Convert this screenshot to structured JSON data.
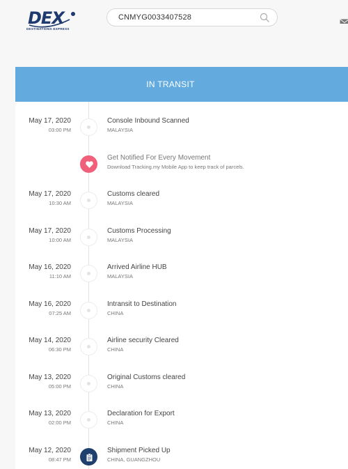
{
  "header": {
    "logo": {
      "brand": "DEX",
      "tagline": "DESTINATIONS EXPRESS"
    },
    "search": {
      "value": "CNMYG0033407528"
    }
  },
  "status": {
    "label": "IN TRANSIT"
  },
  "promo": {
    "title": "Get Notified For Every Movement",
    "description": "Download Tracking.my Mobile App to keep track of parcels."
  },
  "events": [
    {
      "date": "May 17, 2020",
      "time": "03:00 PM",
      "title": "Console Inbound Scanned",
      "location": "MALAYSIA"
    },
    {
      "date": "May 17, 2020",
      "time": "10:30 AM",
      "title": "Customs cleared",
      "location": "MALAYSIA"
    },
    {
      "date": "May 17, 2020",
      "time": "10:00 AM",
      "title": "Customs Processing",
      "location": "MALAYSIA"
    },
    {
      "date": "May 16, 2020",
      "time": "11:10 AM",
      "title": "Arrived Airline HUB",
      "location": "MALAYSIA"
    },
    {
      "date": "May 16, 2020",
      "time": "07:25 AM",
      "title": "Intransit to Destination",
      "location": "CHINA"
    },
    {
      "date": "May 14, 2020",
      "time": "06:30 PM",
      "title": "Airline security Cleared",
      "location": "CHINA"
    },
    {
      "date": "May 13, 2020",
      "time": "05:00 PM",
      "title": "Original Customs cleared",
      "location": "CHINA"
    },
    {
      "date": "May 13, 2020",
      "time": "02:00 PM",
      "title": "Declaration for Export",
      "location": "CHINA"
    },
    {
      "date": "May 12, 2020",
      "time": "08:47 PM",
      "title": "Shipment Picked Up",
      "location": "CHINA, GUANGZHOU"
    }
  ],
  "colors": {
    "status_bar": "#63aadf",
    "promo_node": "#f0607a",
    "pickup_node": "#1f3f6e",
    "brand": "#1f3a6e"
  },
  "icons": {
    "search": "search-icon",
    "mail": "mail-icon",
    "promo": "heart-icon",
    "pickup": "clipboard-icon"
  }
}
